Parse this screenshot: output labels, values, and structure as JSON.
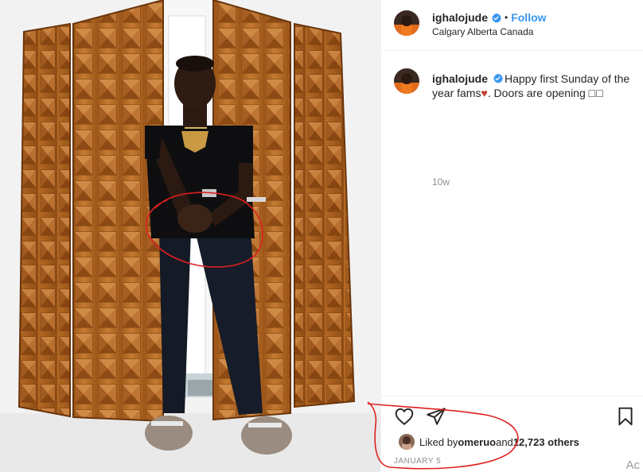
{
  "post": {
    "username": "ighalojude",
    "follow_label": "Follow",
    "separator": "•",
    "location": "Calgary Alberta Canada",
    "caption": {
      "username": "ighalojude",
      "text_before_heart": "Happy first Sunday of the year fams",
      "heart": "♥",
      "text_after_heart": ". Doors are opening ",
      "boxes": "□□"
    },
    "time_ago": "10w",
    "likes": {
      "prefix": "Liked by ",
      "user": "omeruo",
      "middle": " and ",
      "count": "12,723 others"
    },
    "date": "JANUARY 5",
    "corner_text": "Ac"
  },
  "icons": {
    "verified": "verified-badge-icon",
    "like": "heart-outline-icon",
    "share": "paper-plane-icon",
    "save": "bookmark-icon"
  },
  "colors": {
    "follow": "#3897f0",
    "verified": "#3897f0",
    "annotation": "#e02020",
    "door_wood": "#b86a25"
  }
}
